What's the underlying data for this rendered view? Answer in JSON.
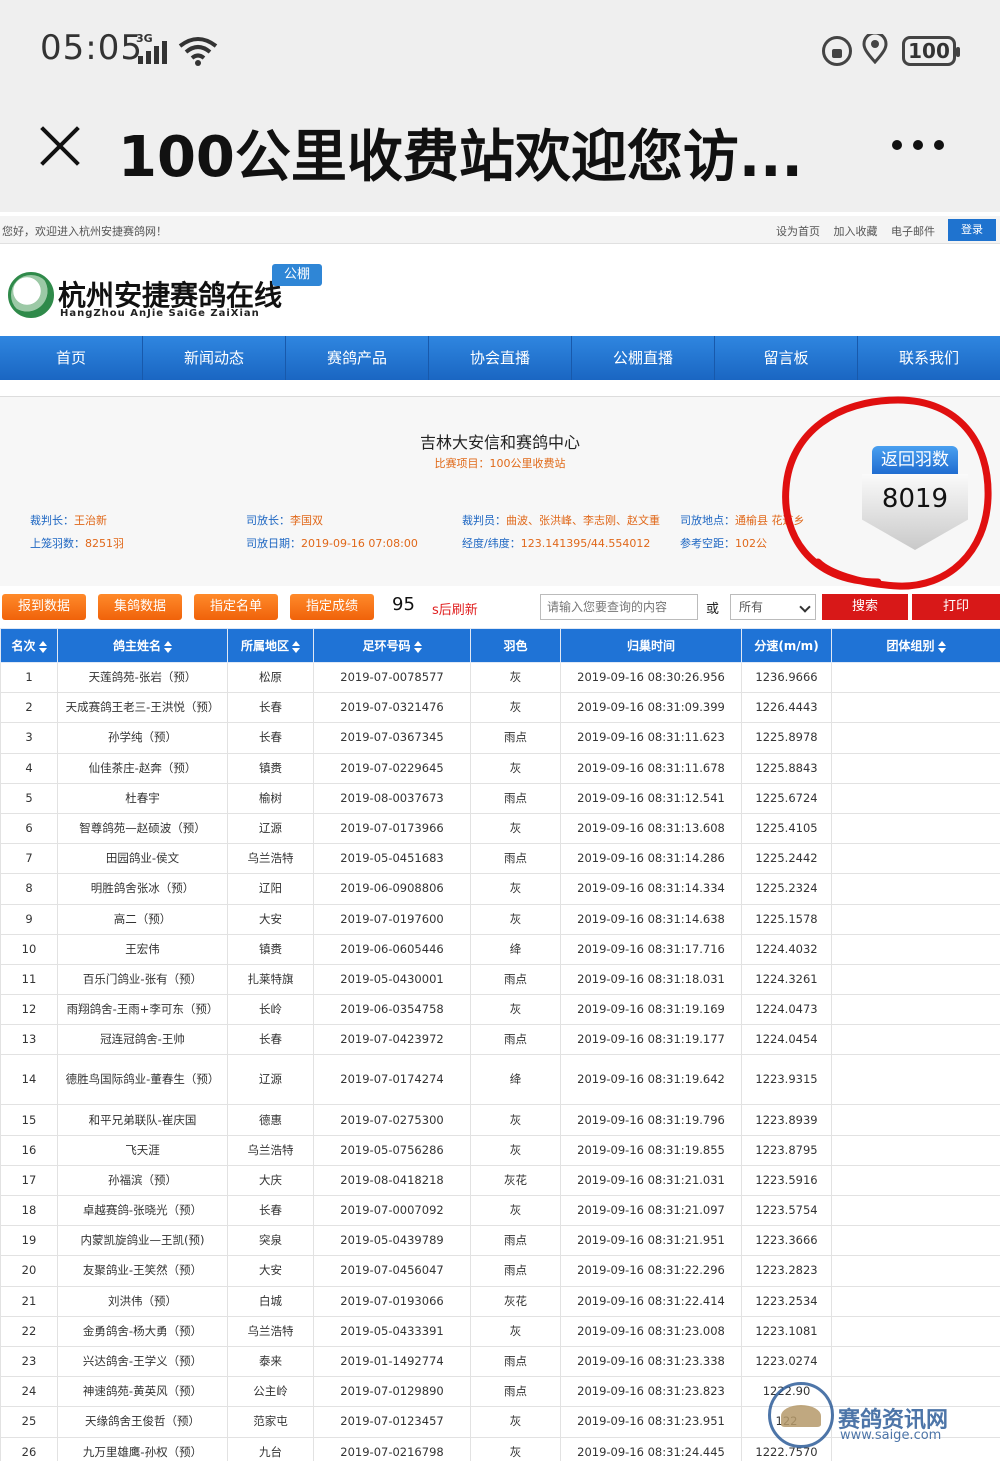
{
  "status": {
    "time": "05:05",
    "network": "3G",
    "battery": "100"
  },
  "app": {
    "title": "100公里收费站欢迎您访..."
  },
  "site": {
    "welcome": "您好，欢迎进入杭州安捷赛鸽网！",
    "top_links": [
      "设为首页",
      "加入收藏",
      "电子邮件"
    ],
    "login": "登录",
    "logo_text": "杭州安捷赛鸽在线",
    "logo_sub": "HangZhou AnJie SaiGe ZaiXian",
    "logo_badge": "公棚"
  },
  "nav": [
    "首页",
    "新闻动态",
    "赛鸽产品",
    "协会直播",
    "公棚直播",
    "留言板",
    "联系我们"
  ],
  "race": {
    "title": "吉林大安信和赛鸽中心",
    "subtitle": "比赛项目：100公里收费站",
    "judge_label": "裁判长：",
    "judge": "王治新",
    "release_chief_label": "司放长：",
    "release_chief": "李国双",
    "referees_label": "裁判员：",
    "referees": "曲波、张洪峰、李志刚、赵文重",
    "release_place_label": "司放地点：",
    "release_place": "通榆县 花道乡",
    "birds_label": "上笼羽数：",
    "birds": "8251羽",
    "release_date_label": "司放日期：",
    "release_date": "2019-09-16 07:08:00",
    "coords_label": "经度/纬度：",
    "coords": "123.141395/44.554012",
    "distance_label": "参考空距：",
    "distance": "102公"
  },
  "back_badge": {
    "label": "返回羽数",
    "count": "8019"
  },
  "toolbar": {
    "buttons": [
      "报到数据",
      "集鸽数据",
      "指定名单",
      "指定成绩"
    ],
    "countdown": "95",
    "refresh_label": "s后刷新",
    "search_placeholder": "请输入您要查询的内容",
    "or": "或",
    "select_value": "所有",
    "search_button": "搜索",
    "print_button": "打印"
  },
  "table": {
    "headers": [
      "名次",
      "鸽主姓名",
      "所属地区",
      "足环号码",
      "羽色",
      "归巢时间",
      "分速(m/m)",
      "团体组别"
    ],
    "rows": [
      [
        "1",
        "天莲鸽苑-张岩（预）",
        "松原",
        "2019-07-0078577",
        "灰",
        "2019-09-16 08:30:26.956",
        "1236.9666",
        ""
      ],
      [
        "2",
        "天成赛鸽王老三-王洪悦（预）",
        "长春",
        "2019-07-0321476",
        "灰",
        "2019-09-16 08:31:09.399",
        "1226.4443",
        ""
      ],
      [
        "3",
        "孙学纯（预）",
        "长春",
        "2019-07-0367345",
        "雨点",
        "2019-09-16 08:31:11.623",
        "1225.8978",
        ""
      ],
      [
        "4",
        "仙佳茶庄-赵奔（预）",
        "镇赉",
        "2019-07-0229645",
        "灰",
        "2019-09-16 08:31:11.678",
        "1225.8843",
        ""
      ],
      [
        "5",
        "杜春宇",
        "榆树",
        "2019-08-0037673",
        "雨点",
        "2019-09-16 08:31:12.541",
        "1225.6724",
        ""
      ],
      [
        "6",
        "智尊鸽苑—赵硕波（预）",
        "辽源",
        "2019-07-0173966",
        "灰",
        "2019-09-16 08:31:13.608",
        "1225.4105",
        ""
      ],
      [
        "7",
        "田园鸽业-侯文",
        "乌兰浩特",
        "2019-05-0451683",
        "雨点",
        "2019-09-16 08:31:14.286",
        "1225.2442",
        ""
      ],
      [
        "8",
        "明胜鸽舍张冰（预）",
        "辽阳",
        "2019-06-0908806",
        "灰",
        "2019-09-16 08:31:14.334",
        "1225.2324",
        ""
      ],
      [
        "9",
        "高二（预）",
        "大安",
        "2019-07-0197600",
        "灰",
        "2019-09-16 08:31:14.638",
        "1225.1578",
        ""
      ],
      [
        "10",
        "王宏伟",
        "镇赉",
        "2019-06-0605446",
        "绛",
        "2019-09-16 08:31:17.716",
        "1224.4032",
        ""
      ],
      [
        "11",
        "百乐门鸽业-张有（预）",
        "扎莱特旗",
        "2019-05-0430001",
        "雨点",
        "2019-09-16 08:31:18.031",
        "1224.3261",
        ""
      ],
      [
        "12",
        "雨翔鸽舍-王雨+李可东（预）",
        "长岭",
        "2019-06-0354758",
        "灰",
        "2019-09-16 08:31:19.169",
        "1224.0473",
        ""
      ],
      [
        "13",
        "冠连冠鸽舍-王帅",
        "长春",
        "2019-07-0423972",
        "雨点",
        "2019-09-16 08:31:19.177",
        "1224.0454",
        ""
      ],
      [
        "14",
        "德胜鸟国际鸽业-董春生（预）",
        "辽源",
        "2019-07-0174274",
        "绛",
        "2019-09-16 08:31:19.642",
        "1223.9315",
        ""
      ],
      [
        "15",
        "和平兄弟联队-崔庆国",
        "德惠",
        "2019-07-0275300",
        "灰",
        "2019-09-16 08:31:19.796",
        "1223.8939",
        ""
      ],
      [
        "16",
        "飞天涯",
        "乌兰浩特",
        "2019-05-0756286",
        "灰",
        "2019-09-16 08:31:19.855",
        "1223.8795",
        ""
      ],
      [
        "17",
        "孙福滨（预）",
        "大庆",
        "2019-08-0418218",
        "灰花",
        "2019-09-16 08:31:21.031",
        "1223.5916",
        ""
      ],
      [
        "18",
        "卓越赛鸽-张晓光（预）",
        "长春",
        "2019-07-0007092",
        "灰",
        "2019-09-16 08:31:21.097",
        "1223.5754",
        ""
      ],
      [
        "19",
        "内蒙凯旋鸽业—王凯(预)",
        "突泉",
        "2019-05-0439789",
        "雨点",
        "2019-09-16 08:31:21.951",
        "1223.3666",
        ""
      ],
      [
        "20",
        "友聚鸽业-王笑然（预）",
        "大安",
        "2019-07-0456047",
        "雨点",
        "2019-09-16 08:31:22.296",
        "1223.2823",
        ""
      ],
      [
        "21",
        "刘洪伟（预）",
        "白城",
        "2019-07-0193066",
        "灰花",
        "2019-09-16 08:31:22.414",
        "1223.2534",
        ""
      ],
      [
        "22",
        "金勇鸽舍-杨大勇（预）",
        "乌兰浩特",
        "2019-05-0433391",
        "灰",
        "2019-09-16 08:31:23.008",
        "1223.1081",
        ""
      ],
      [
        "23",
        "兴达鸽舍-王学义（预）",
        "泰来",
        "2019-01-1492774",
        "雨点",
        "2019-09-16 08:31:23.338",
        "1223.0274",
        ""
      ],
      [
        "24",
        "神速鸽苑-黄英风（预）",
        "公主岭",
        "2019-07-0129890",
        "雨点",
        "2019-09-16 08:31:23.823",
        "1222.90",
        ""
      ],
      [
        "25",
        "天缘鸽舍王俊哲（预）",
        "范家屯",
        "2019-07-0123457",
        "灰",
        "2019-09-16 08:31:23.951",
        "122",
        ""
      ],
      [
        "26",
        "九万里雄鹰-孙权（预）",
        "九台",
        "2019-07-0216798",
        "灰",
        "2019-09-16 08:31:24.445",
        "1222.7570",
        ""
      ]
    ]
  },
  "watermark": {
    "name": "赛鸽资讯网",
    "url": "www.saige.com"
  },
  "colors": {
    "nav_blue": "#1f73d6",
    "orange": "#f0620a",
    "red": "#d81818",
    "annotation": "#e01010"
  }
}
